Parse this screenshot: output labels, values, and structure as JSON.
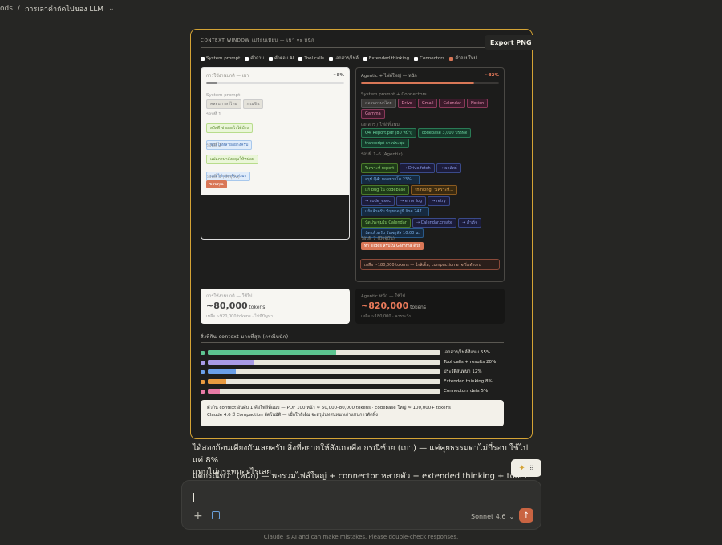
{
  "breadcrumb": {
    "prev": "ods",
    "sep": "/",
    "current": "การเลาคำถัดไปของ LLM"
  },
  "artifact": {
    "export_label": "Export PNG",
    "title": "CONTEXT WINDOW เปรียบเทียบ — เบา vs หนัก",
    "legend": [
      {
        "label": "System prompt",
        "on": false
      },
      {
        "label": "คำถาม",
        "on": false
      },
      {
        "label": "คำตอบ AI",
        "on": false
      },
      {
        "label": "Tool calls",
        "on": false
      },
      {
        "label": "เอกสาร/ไฟล์",
        "on": false
      },
      {
        "label": "Extended thinking",
        "on": false
      },
      {
        "label": "Connectors",
        "on": false
      },
      {
        "label": "คำถามใหม่",
        "on": true
      }
    ],
    "light": {
      "header": "การใช้งานปกติ — เบา",
      "pct": "~8%",
      "sys_label": "System prompt",
      "sys_pills": [
        "คลอบภาษาไทย",
        "กรมชิน"
      ],
      "turn1": "รอบที่ 1",
      "turn1_pills": [
        "สวัสดี ช่วยอะไรได้บ้าง",
        "ช่วยได้หลายอย่างครับ"
      ],
      "turn2": "รอบที่ 2",
      "turn2_pills": [
        "แปลภาษาอังกฤษให้หน่อย",
        "แปลได้เลยครับ ส่งมา"
      ],
      "turn3": "รอบที่ 3 (ปัจจุบัน)",
      "turn3_pill": "ขอบคุณ"
    },
    "heavy": {
      "header": "Agentic + ไฟล์ใหญ่ — หนัก",
      "pct": "~82%",
      "sys_label": "System prompt + Connectors",
      "sys_pills": [
        "คลอบภาษาไทย",
        "Drive",
        "Gmail",
        "Calendar",
        "Notion"
      ],
      "sys_pill2": "Gamma",
      "files_label": "เอกสาร / ไฟล์ที่แนบ",
      "files_pills": [
        "Q4_Report.pdf (80 หน้า)",
        "codebase 3,000 บรรทัด"
      ],
      "files_pill2": "transcript การประชุม",
      "turns_label": "รอบที่ 1–6 (Agentic)",
      "rows": [
        [
          "วิเคราะห์ report",
          "→ Drive.fetch",
          "→ ผลลัพธ์"
        ],
        [
          "สรุป Q4: ยอดขายโต 23%..."
        ],
        [
          "แก้ bug ใน codebase",
          "thinking: วิเคราะห์..."
        ],
        [
          "→ code_exec",
          "→ error log",
          "→ retry"
        ],
        [
          "แก้แล้วครับ ปัญหาอยู่ที่ line 247..."
        ],
        [
          "นัดประชุมใน Calendar",
          "→ Calendar.create",
          "→ สำเร็จ"
        ],
        [
          "นัดแล้วครับ วันพฤหัส 10.00 น."
        ]
      ],
      "current_label": "รอบที่ 7 (ปัจจุบัน)",
      "current_pill": "ทำ slides สรุปใน Gamma ด้วย",
      "remaining": "เหลือ ~180,000 tokens — ใกล้เต็ม, compaction อาจเริ่มทำงาน"
    },
    "light_stat": {
      "label": "การใช้งานปกติ — ใช้ไป",
      "value": "~80,000",
      "unit": "tokens",
      "sub": "เหลือ ~920,000 tokens · ไม่มีปัญหา"
    },
    "heavy_stat": {
      "label": "Agentic หนัก — ใช้ไป",
      "value": "~820,000",
      "unit": "tokens",
      "sub": "เหลือ ~180,000 · ควรระวัง"
    },
    "dist_title": "สิ่งที่กิน context มากที่สุด (กรณีหนัก)",
    "dist": [
      {
        "label": "เอกสาร/ไฟล์ที่แนบ 55%",
        "pct": 55,
        "color": "#5cc490"
      },
      {
        "label": "Tool calls + results 20%",
        "pct": 20,
        "color": "#a89be6"
      },
      {
        "label": "ประวัติสนทนา 12%",
        "pct": 12,
        "color": "#6a9fe8"
      },
      {
        "label": "Extended thinking 8%",
        "pct": 8,
        "color": "#e89a40"
      },
      {
        "label": "Connectors defs 5%",
        "pct": 5,
        "color": "#e87aa5"
      }
    ],
    "note_line1": "ตัวกิน context อันดับ 1 คือไฟล์ที่แนบ — PDF 100 หน้า ≈ 50,000–80,000 tokens · codebase ใหญ่ ≈ 100,000+ tokens",
    "note_line2": "Claude 4.6 มี Compaction อัตโนมัติ — เมื่อใกล้เต็ม จะสรุปบทสนทนาเก่าแทนการตัดทิ้ง"
  },
  "message": {
    "p1": "ได้สองก้อนเคียงกันเลยครับ สิ่งที่อยากให้สังเกตคือ กรณีซ้าย (เบา) — แค่คุยธรรมดาไม่กี่รอบ ใช้ไปแค่ 8%",
    "p1b": "แทบไม่กระทบอะไรเลย",
    "p2": "แต่กรณีขวา (หนัก) — พอรวมไฟล์ใหญ่ + connector หลายตัว + extended thinking + tool calls หลาย"
  },
  "input": {
    "model": "Sonnet 4.6",
    "chevron": "⌄",
    "plus": "+",
    "send": "↑"
  },
  "footer": "Claude is AI and can make mistakes. Please double-check responses.",
  "colors": {
    "accent": "#d4a335",
    "send": "#c96442"
  }
}
